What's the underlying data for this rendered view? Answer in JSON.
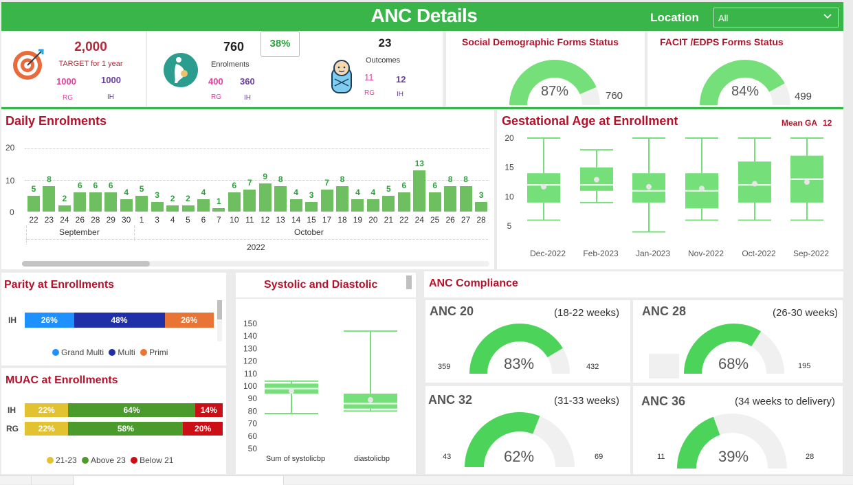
{
  "header": {
    "title": "ANC Details",
    "location_label": "Location",
    "location_value": "All"
  },
  "kpi": {
    "target": {
      "value": "2,000",
      "label": "TARGET for 1 year",
      "rg_value": "1000",
      "ih_value": "1000",
      "rg_label": "RG",
      "ih_label": "IH"
    },
    "enrolments": {
      "value": "760",
      "label": "Enrolments",
      "pct": "38%",
      "rg_value": "400",
      "ih_value": "360",
      "rg_label": "RG",
      "ih_label": "IH"
    },
    "outcomes": {
      "value": "23",
      "label": "Outcomes",
      "rg_value": "11",
      "ih_value": "12",
      "rg_label": "RG",
      "ih_label": "IH"
    }
  },
  "social_forms": {
    "title": "Social Demographic Forms Status",
    "pct": "87%",
    "total": "760",
    "fraction": 0.87
  },
  "facit_forms": {
    "title": "FACIT /EDPS Forms Status",
    "pct": "84%",
    "total": "499",
    "fraction": 0.84
  },
  "daily": {
    "title": "Daily Enrolments",
    "month_sep": "September",
    "month_oct": "October",
    "year": "2022",
    "y_ticks": [
      "20",
      "10",
      "0"
    ]
  },
  "chart_data": [
    {
      "type": "bar",
      "title": "Daily Enrolments",
      "categories": [
        "22",
        "23",
        "24",
        "26",
        "28",
        "29",
        "30",
        "1",
        "3",
        "4",
        "5",
        "6",
        "7",
        "10",
        "11",
        "12",
        "13",
        "14",
        "15",
        "17",
        "18",
        "19",
        "20",
        "21",
        "22",
        "24",
        "25",
        "26",
        "27",
        "28"
      ],
      "values": [
        5,
        8,
        2,
        6,
        6,
        6,
        4,
        5,
        3,
        2,
        2,
        4,
        1,
        6,
        7,
        9,
        8,
        4,
        3,
        7,
        8,
        4,
        4,
        5,
        6,
        13,
        6,
        8,
        8,
        3
      ],
      "ylim": [
        0,
        20
      ]
    },
    {
      "type": "box",
      "title": "Gestational Age at Enrollment",
      "categories": [
        "Dec-2022",
        "Feb-2023",
        "Jan-2023",
        "Nov-2022",
        "Oct-2022",
        "Sep-2022"
      ],
      "y_ticks": [
        "20",
        "15",
        "10",
        "5"
      ],
      "ylim": [
        3,
        20
      ],
      "boxes": [
        {
          "min": 6,
          "q1": 9,
          "median": 12,
          "q3": 14,
          "max": 20,
          "mean": 11.7
        },
        {
          "min": 9,
          "q1": 11,
          "median": 12,
          "q3": 15,
          "max": 18,
          "mean": 12.9
        },
        {
          "min": 4,
          "q1": 9,
          "median": 11,
          "q3": 14,
          "max": 20,
          "mean": 11.7
        },
        {
          "min": 6,
          "q1": 8,
          "median": 11,
          "q3": 14,
          "max": 20,
          "mean": 11.4
        },
        {
          "min": 6,
          "q1": 9,
          "median": 12,
          "q3": 16,
          "max": 20,
          "mean": 12.2
        },
        {
          "min": 6,
          "q1": 9,
          "median": 13,
          "q3": 17,
          "max": 20,
          "mean": 12.5
        }
      ]
    },
    {
      "type": "box",
      "title": "Systolic and Diastolic",
      "categories": [
        "Sum of systolicbp",
        "diastolicbp"
      ],
      "y_ticks": [
        "150",
        "140",
        "130",
        "120",
        "110",
        "100",
        "90",
        "80",
        "70",
        "60",
        "50"
      ],
      "ylim": [
        50,
        150
      ],
      "boxes": [
        {
          "min": 78,
          "q1": 94,
          "median": 98,
          "q3": 102,
          "max": 104,
          "mean": 96
        },
        {
          "min": 80,
          "q1": 82,
          "median": 86,
          "q3": 94,
          "max": 144,
          "mean": 89
        }
      ]
    },
    {
      "type": "bar",
      "title": "Parity at Enrollments",
      "categories": [
        "IH"
      ],
      "series": [
        {
          "name": "Grand Multi",
          "values": [
            26
          ]
        },
        {
          "name": "Multi",
          "values": [
            48
          ]
        },
        {
          "name": "Primi",
          "values": [
            26
          ]
        }
      ]
    },
    {
      "type": "bar",
      "title": "MUAC at Enrollments",
      "categories": [
        "IH",
        "RG"
      ],
      "series": [
        {
          "name": "21-23",
          "values": [
            22,
            22
          ]
        },
        {
          "name": "Above 23",
          "values": [
            64,
            58
          ]
        },
        {
          "name": "Below 21",
          "values": [
            14,
            20
          ]
        }
      ]
    }
  ],
  "gest": {
    "title": "Gestational Age at Enrollment",
    "mean_label": "Mean GA",
    "mean_value": "12"
  },
  "parity": {
    "title": "Parity at Enrollments",
    "row": "IH",
    "segs": [
      "26%",
      "48%",
      "26%"
    ],
    "legend": [
      "Grand Multi",
      "Multi",
      "Primi"
    ]
  },
  "muac": {
    "title": "MUAC at Enrollments",
    "rows": [
      {
        "label": "IH",
        "segs": [
          "22%",
          "64%",
          "14%"
        ]
      },
      {
        "label": "RG",
        "segs": [
          "22%",
          "58%",
          "20%"
        ]
      }
    ],
    "legend": [
      "21-23",
      "Above 23",
      "Below 21"
    ]
  },
  "bp": {
    "title": "Systolic and Diastolic"
  },
  "anc": {
    "title": "ANC Compliance",
    "cards": [
      {
        "title": "ANC 20",
        "range": "(18-22 weeks)",
        "pct": "83%",
        "left": "359",
        "right": "432",
        "fraction": 0.83
      },
      {
        "title": "ANC 28",
        "range": "(26-30 weeks)",
        "pct": "68%",
        "left": "",
        "right": "195",
        "fraction": 0.68
      },
      {
        "title": "ANC 32",
        "range": "(31-33 weeks)",
        "pct": "62%",
        "left": "43",
        "right": "69",
        "fraction": 0.62
      },
      {
        "title": "ANC 36",
        "range": "(34 weeks to delivery)",
        "pct": "39%",
        "left": "11",
        "right": "28",
        "fraction": 0.39
      }
    ]
  },
  "colors": {
    "brand_green": "#3ab54a",
    "bar_green": "#6dbf60",
    "gauge_green": "#4cd35a",
    "title_red": "#b4122a",
    "grand_multi": "#1e90ff",
    "multi": "#1f2fa8",
    "primi": "#e87535",
    "muac_mid": "#e3c232",
    "muac_above": "#4a9a2c",
    "muac_below": "#cc0e16"
  },
  "icons": [
    "target-icon",
    "pregnant-icon",
    "baby-icon",
    "chevron-down-icon"
  ]
}
